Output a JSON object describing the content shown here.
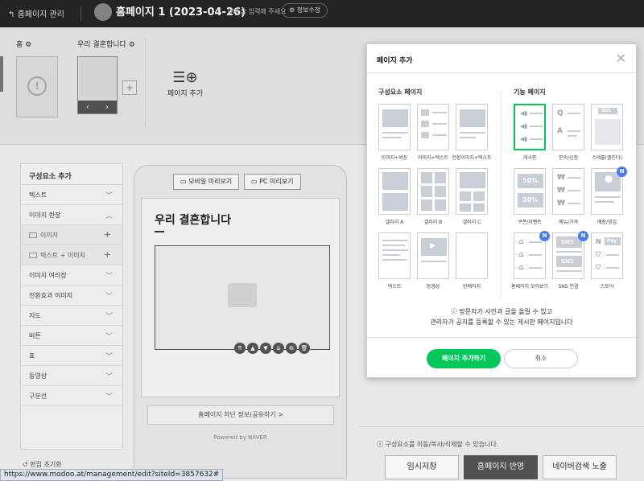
{
  "topbar": {
    "back_label": "홈페이지 관리",
    "site_title": "홈페이지 1 (2023-04-26)",
    "url_hint": "URL을 입력해 주세요",
    "edit_info": "정보수정"
  },
  "pages": {
    "home_label": "홈",
    "wedding_label": "우리 결혼합니다",
    "add_page_label": "페이지 추가"
  },
  "components": {
    "heading": "구성요소 추가",
    "items": [
      {
        "label": "텍스트"
      },
      {
        "label": "이미지 한장"
      },
      {
        "label": "이미지"
      },
      {
        "label": "텍스트 + 이미지"
      },
      {
        "label": "이미지 여러장"
      },
      {
        "label": "전환효과 이미지"
      },
      {
        "label": "지도"
      },
      {
        "label": "버튼"
      },
      {
        "label": "표"
      },
      {
        "label": "동영상"
      },
      {
        "label": "구분선"
      }
    ]
  },
  "preview": {
    "mobile_btn": "모바일 미리보기",
    "pc_btn": "PC 미리보기",
    "heading": "우리 결혼합니다",
    "footer_link": "홈페이지 하단 정보(공유하기 >",
    "powered": "Powered by NAVER"
  },
  "bottom": {
    "notice": "ⓘ 구성요소를 이동/복사/삭제할 수 있습니다.",
    "save_btn": "임시저장",
    "apply_btn": "홈페이지 반영",
    "naver_btn": "네이버검색 노출",
    "history": "편집 초기화",
    "status_url": "https://www.modoo.at/management/edit?siteId=3857632#"
  },
  "modal": {
    "title": "페이지 추가",
    "left_section": "구성요소 페이지",
    "right_section": "기능 페이지",
    "left_tiles": [
      {
        "label": "이미지+버튼"
      },
      {
        "label": "이미지+텍스트"
      },
      {
        "label": "전환이미지+텍스트"
      },
      {
        "label": "갤러리 A"
      },
      {
        "label": "갤러리 B"
      },
      {
        "label": "갤러리 C"
      },
      {
        "label": "텍스트"
      },
      {
        "label": "동영상"
      },
      {
        "label": "빈페이지"
      }
    ],
    "right_tiles": [
      {
        "label": "게시판"
      },
      {
        "label": "문의/신청"
      },
      {
        "label": "스케줄(캘린더)"
      },
      {
        "label": "쿠폰/이벤트"
      },
      {
        "label": "메뉴/가격"
      },
      {
        "label": "매장/영업"
      },
      {
        "label": "홈페이지 모아보기"
      },
      {
        "label": "SNS 연결"
      },
      {
        "label": "스토어"
      }
    ],
    "tile_text": {
      "coupon_50": "50%",
      "coupon_30": "30%",
      "sns": "SNS",
      "oct": "Oct",
      "pay": "Pay",
      "n": "N"
    },
    "desc_line1": "ⓘ 방문자가 사진과 글을 올릴 수 있고",
    "desc_line2": "관리자가 공지를 등록할 수 있는 게시판 페이지입니다",
    "add_btn": "페이지 추가하기",
    "cancel_btn": "취소",
    "accent_color": "#03c75a",
    "badge_color": "#4a7cf0"
  }
}
